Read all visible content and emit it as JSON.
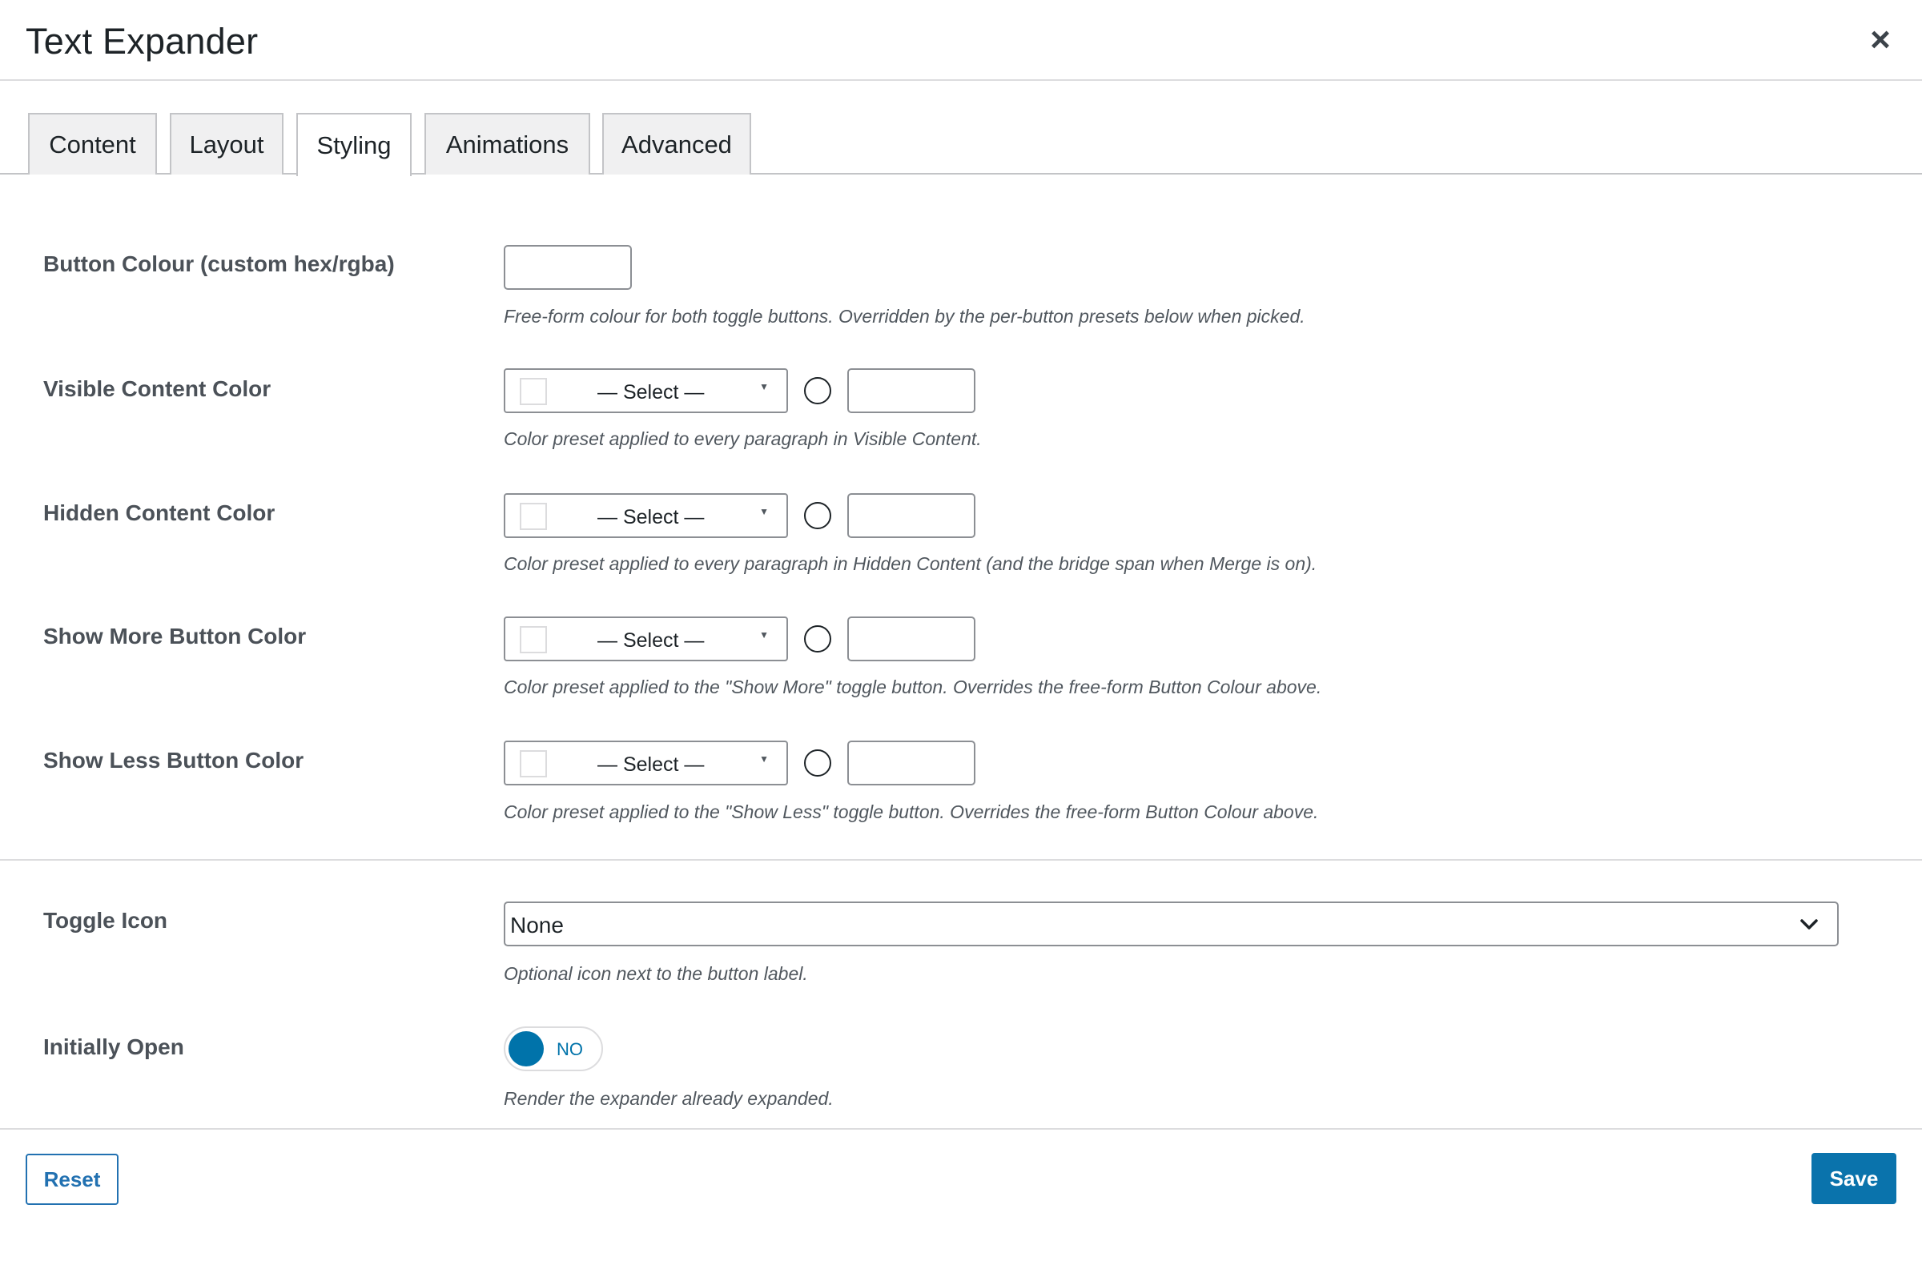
{
  "window": {
    "title": "Text Expander",
    "close_symbol": "×"
  },
  "tabs": [
    {
      "label": "Content",
      "active": false
    },
    {
      "label": "Layout",
      "active": false
    },
    {
      "label": "Styling",
      "active": true
    },
    {
      "label": "Animations",
      "active": false
    },
    {
      "label": "Advanced",
      "active": false
    }
  ],
  "fields": {
    "button_colour": {
      "label": "Button Colour (custom hex/rgba)",
      "value": "",
      "help": "Free-form colour for both toggle buttons. Overridden by the per-button presets below when picked."
    },
    "visible_content_color": {
      "label": "Visible Content Color",
      "select": "— Select —",
      "custom_value": "",
      "help": "Color preset applied to every paragraph in Visible Content."
    },
    "hidden_content_color": {
      "label": "Hidden Content Color",
      "select": "— Select —",
      "custom_value": "",
      "help": "Color preset applied to every paragraph in Hidden Content (and the bridge span when Merge is on)."
    },
    "show_more_button_color": {
      "label": "Show More Button Color",
      "select": "— Select —",
      "custom_value": "",
      "help": "Color preset applied to the \"Show More\" toggle button. Overrides the free-form Button Colour above."
    },
    "show_less_button_color": {
      "label": "Show Less Button Color",
      "select": "— Select —",
      "custom_value": "",
      "help": "Color preset applied to the \"Show Less\" toggle button. Overrides the free-form Button Colour above."
    },
    "toggle_icon": {
      "label": "Toggle Icon",
      "value": "None",
      "help": "Optional icon next to the button label."
    },
    "initially_open": {
      "label": "Initially Open",
      "state": "NO",
      "help": "Render the expander already expanded."
    }
  },
  "footer": {
    "reset_label": "Reset",
    "save_label": "Save"
  },
  "colors": {
    "accent": "#0073aa",
    "save_button": "#0a73ac",
    "border": "#8c8f94"
  }
}
